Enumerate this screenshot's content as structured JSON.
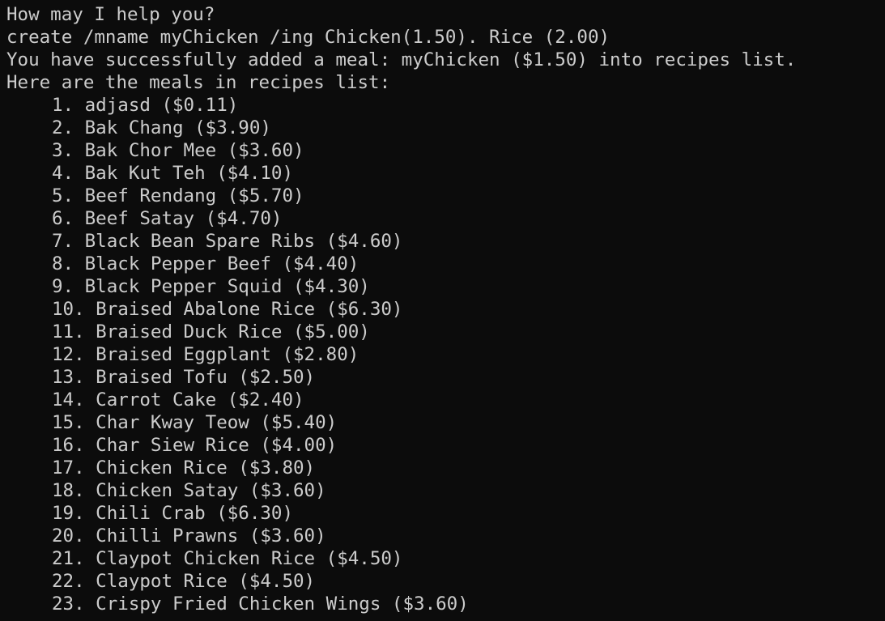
{
  "terminal": {
    "prompt": "How may I help you?",
    "command": "create /mname myChicken /ing Chicken(1.50). Rice (2.00)",
    "success_message": "You have successfully added a meal: myChicken ($1.50) into recipes list.",
    "list_header": "Here are the meals in recipes list:",
    "meals": [
      "1. adjasd ($0.11)",
      "2. Bak Chang ($3.90)",
      "3. Bak Chor Mee ($3.60)",
      "4. Bak Kut Teh ($4.10)",
      "5. Beef Rendang ($5.70)",
      "6. Beef Satay ($4.70)",
      "7. Black Bean Spare Ribs ($4.60)",
      "8. Black Pepper Beef ($4.40)",
      "9. Black Pepper Squid ($4.30)",
      "10. Braised Abalone Rice ($6.30)",
      "11. Braised Duck Rice ($5.00)",
      "12. Braised Eggplant ($2.80)",
      "13. Braised Tofu ($2.50)",
      "14. Carrot Cake ($2.40)",
      "15. Char Kway Teow ($5.40)",
      "16. Char Siew Rice ($4.00)",
      "17. Chicken Rice ($3.80)",
      "18. Chicken Satay ($3.60)",
      "19. Chili Crab ($6.30)",
      "20. Chilli Prawns ($3.60)",
      "21. Claypot Chicken Rice ($4.50)",
      "22. Claypot Rice ($4.50)",
      "23. Crispy Fried Chicken Wings ($3.60)"
    ]
  }
}
